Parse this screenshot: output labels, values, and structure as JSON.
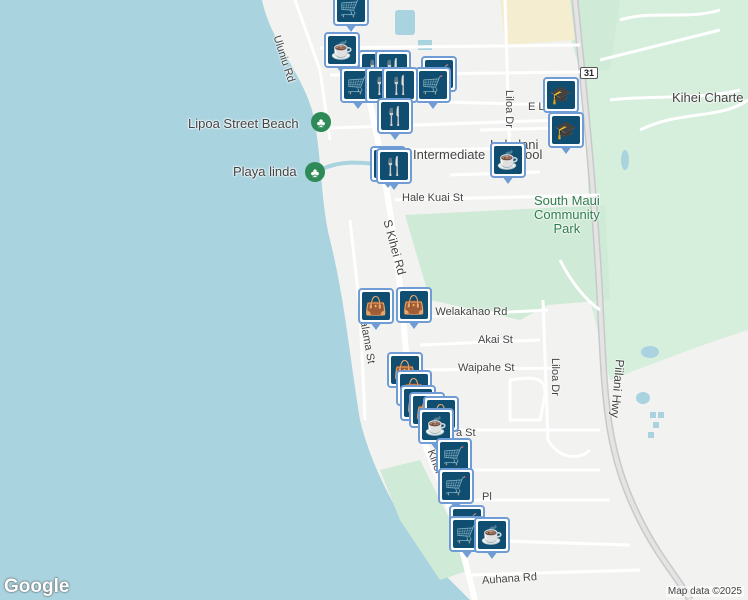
{
  "map": {
    "colors": {
      "water": "#a9d3df",
      "land": "#f2f2f0",
      "park": "#cfead6",
      "road": "#ffffff",
      "highway": "#c9c9c9"
    },
    "roads": [
      {
        "key": "uluniu",
        "label": "Uluniu Rd"
      },
      {
        "key": "eli",
        "label": "E Lil"
      },
      {
        "key": "liloa_n",
        "label": "Liloa Dr"
      },
      {
        "key": "hale_kuai",
        "label": "Hale Kuai St"
      },
      {
        "key": "s_kihei",
        "label": "S Kihei Rd"
      },
      {
        "key": "welakahao",
        "label": "E Welakahao Rd"
      },
      {
        "key": "akai",
        "label": "Akai St"
      },
      {
        "key": "waipahe",
        "label": "Waipahe St"
      },
      {
        "key": "liloa_s",
        "label": "Liloa Dr"
      },
      {
        "key": "halama",
        "label": "Halama St"
      },
      {
        "key": "piilani",
        "label": "Piilani Hwy"
      },
      {
        "key": "auhana",
        "label": "Auhana Rd"
      },
      {
        "key": "pl",
        "label": "Pl"
      },
      {
        "key": "a_st",
        "label": "a St"
      },
      {
        "key": "kihei_s",
        "label": "Kihei"
      }
    ],
    "shield": "31",
    "pois": [
      {
        "key": "lipoa",
        "label": "Lipoa Street Beach"
      },
      {
        "key": "playa",
        "label": "Playa linda"
      },
      {
        "key": "intermediate",
        "label": "Intermediate"
      },
      {
        "key": "lokelani",
        "label": "Lokelani"
      },
      {
        "key": "ool",
        "label": "ool"
      },
      {
        "key": "charter",
        "label": "Kihei Charte"
      }
    ],
    "park_label": [
      "South Maui",
      "Community",
      "Park"
    ],
    "markers": [
      {
        "type": "shopping-cart"
      },
      {
        "type": "coffee"
      },
      {
        "type": "restaurant"
      },
      {
        "type": "shopping-cart"
      },
      {
        "type": "restaurant"
      },
      {
        "type": "shopping-cart"
      },
      {
        "type": "restaurant"
      },
      {
        "type": "restaurant"
      },
      {
        "type": "school"
      },
      {
        "type": "school"
      },
      {
        "type": "coffee"
      },
      {
        "type": "restaurant"
      },
      {
        "type": "shopping-bag"
      },
      {
        "type": "shopping-bag"
      },
      {
        "type": "shopping-bag"
      },
      {
        "type": "shopping-bag"
      },
      {
        "type": "shopping-bag"
      },
      {
        "type": "coffee"
      },
      {
        "type": "shopping-cart"
      },
      {
        "type": "shopping-cart"
      },
      {
        "type": "shopping-cart"
      },
      {
        "type": "coffee"
      }
    ],
    "logo": "Google",
    "attribution": "Map data ©2025"
  }
}
